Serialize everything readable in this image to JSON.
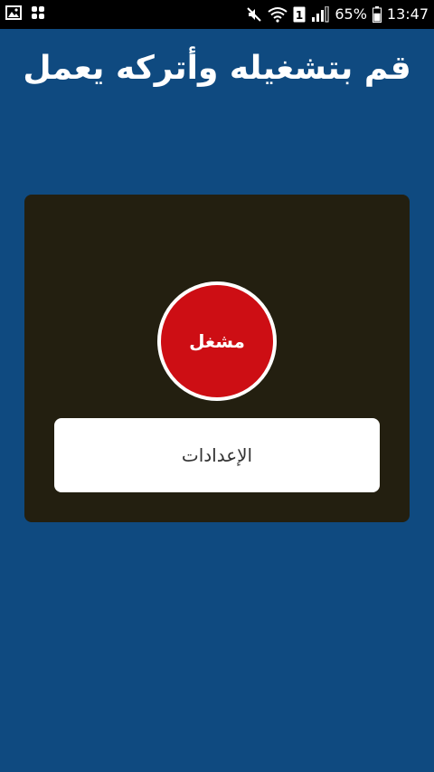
{
  "status_bar": {
    "left_icons": [
      "gallery-icon",
      "apps-grid-icon"
    ],
    "right_icons": [
      "mute-icon",
      "wifi-icon",
      "sim-1-icon",
      "signal-icon",
      "battery-icon"
    ],
    "sim_label": "1",
    "battery": "65%",
    "battery_level": 0.65,
    "time": "13:47"
  },
  "title": "قم بتشغيله وأتركه يعمل",
  "main": {
    "toggle_label": "مشغل",
    "settings_label": "الإعدادات"
  },
  "colors": {
    "background": "#0f4a80",
    "card": "#231f10",
    "toggle": "#cd0e14",
    "button": "#ffffff"
  }
}
